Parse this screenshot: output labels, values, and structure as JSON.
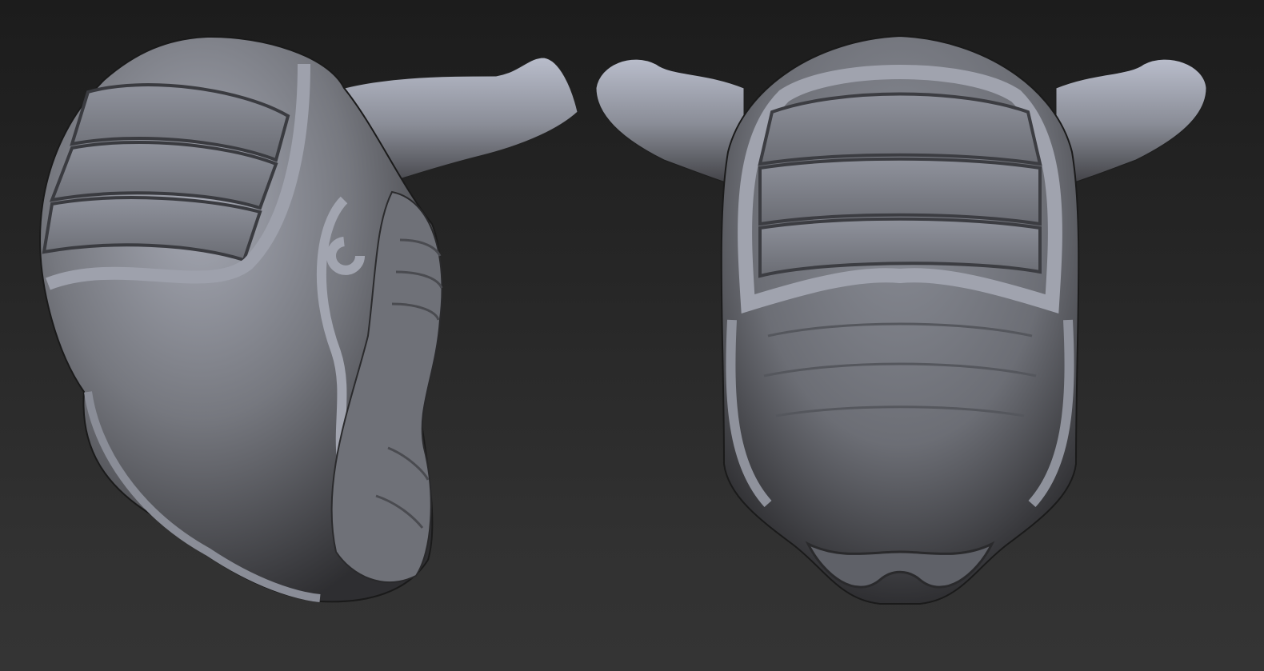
{
  "scene": {
    "background_top": "#1c1c1c",
    "background_bottom": "#343434",
    "model_base_color": "#7a7c84",
    "model_highlight_color": "#b4b8c6",
    "model_shadow_color": "#2a2a2c",
    "views": [
      "side-view",
      "front-view"
    ]
  }
}
